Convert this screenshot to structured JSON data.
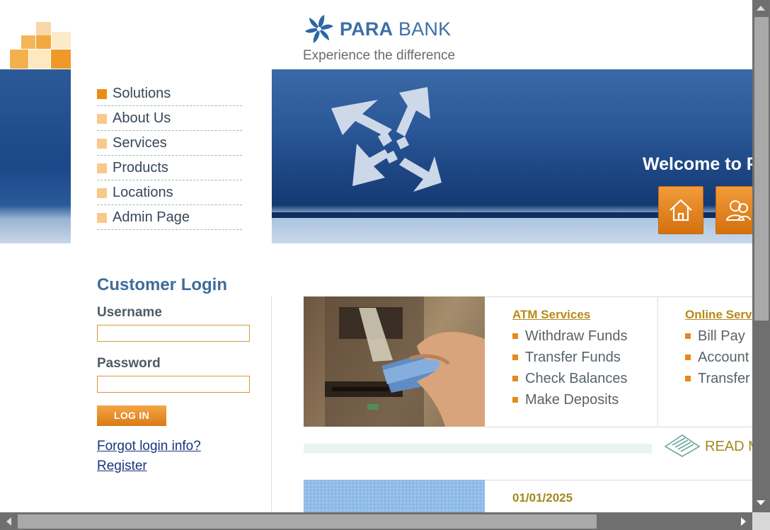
{
  "brand": {
    "name_bold": "PARA",
    "name_regular": "BANK",
    "tagline": "Experience the difference",
    "logo_icon": "pinwheel-icon"
  },
  "hero": {
    "welcome": "Welcome to P",
    "buttons": [
      {
        "icon": "home-icon"
      },
      {
        "icon": "contact-icon"
      }
    ]
  },
  "nav": {
    "items": [
      {
        "label": "Solutions",
        "active": true
      },
      {
        "label": "About Us"
      },
      {
        "label": "Services"
      },
      {
        "label": "Products"
      },
      {
        "label": "Locations"
      },
      {
        "label": "Admin Page"
      }
    ]
  },
  "login": {
    "title": "Customer Login",
    "username_label": "Username",
    "username_value": "",
    "password_label": "Password",
    "password_value": "",
    "button": "LOG IN",
    "forgot": "Forgot login info?",
    "register": "Register"
  },
  "services": {
    "atm": {
      "heading": "ATM Services",
      "items": [
        "Withdraw Funds",
        "Transfer Funds",
        "Check Balances",
        "Make Deposits"
      ]
    },
    "online": {
      "heading": "Online Serv",
      "items": [
        "Bill Pay",
        "Account",
        "Transfer"
      ]
    },
    "read_more": "READ M"
  },
  "news": {
    "date": "01/01/2025"
  },
  "colors": {
    "accent_orange": "#ea8b16",
    "brand_blue": "#3e6fa8",
    "link_olive": "#b8891a"
  }
}
